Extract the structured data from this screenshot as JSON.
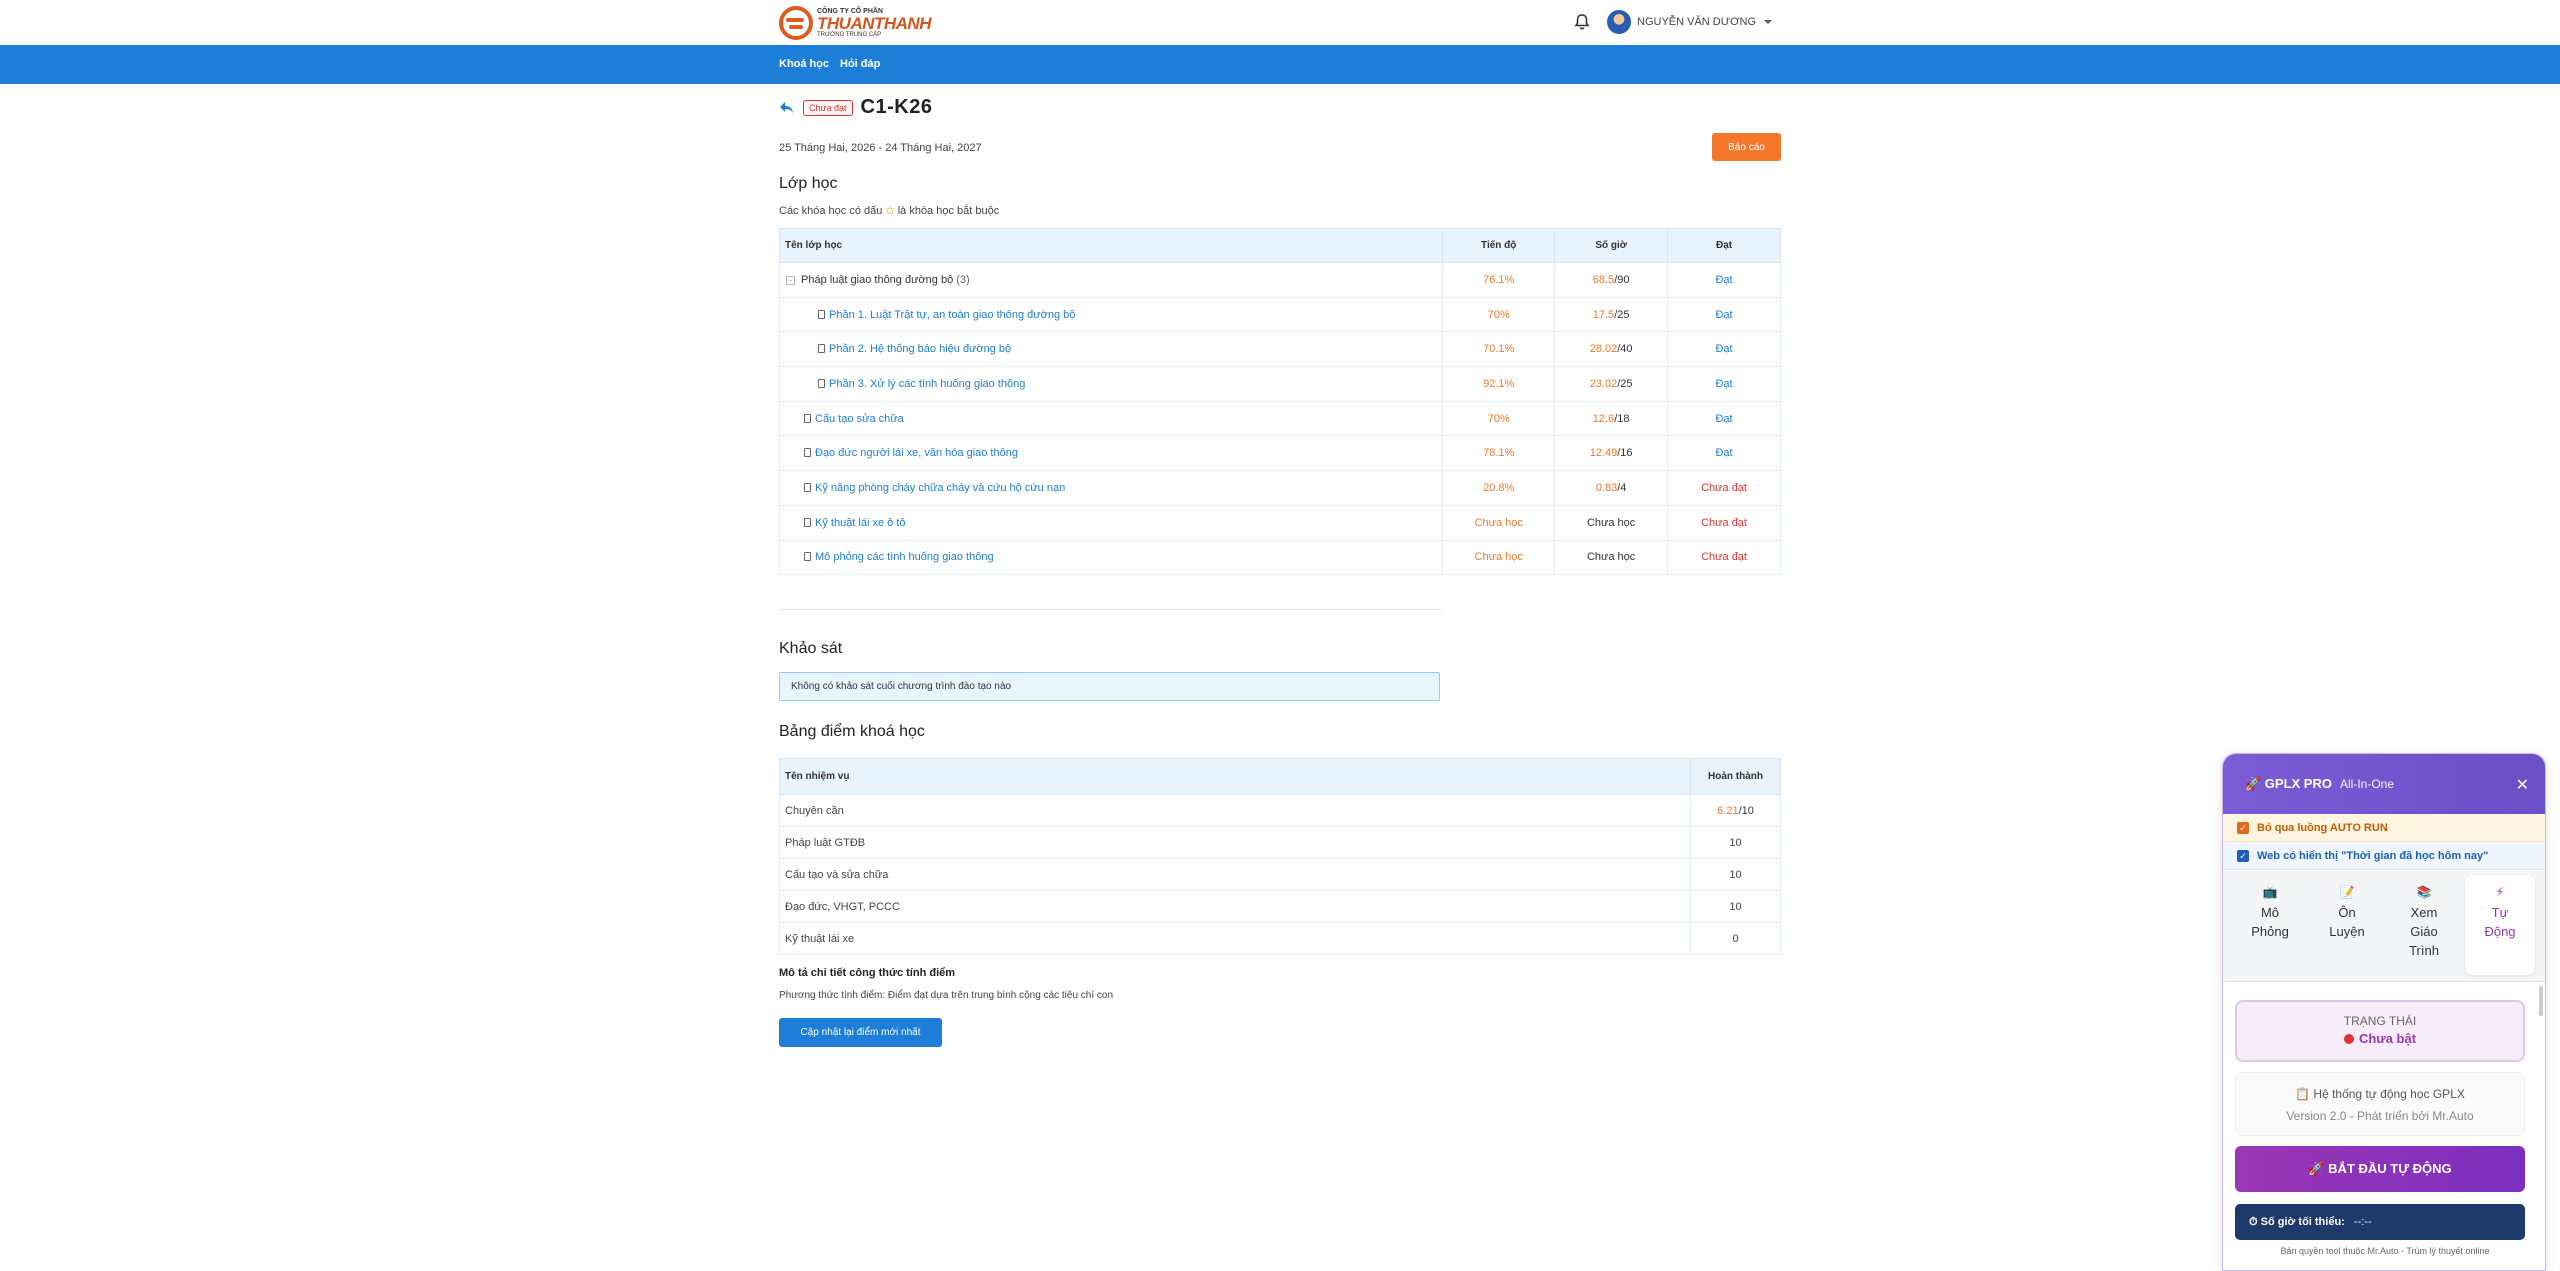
{
  "header": {
    "logo": {
      "small": "CÔNG TY CỔ PHẦN",
      "big": "THUANTHANH",
      "sub": "TRƯỜNG TRUNG CẤP"
    },
    "user_name": "NGUYỄN VĂN DƯƠNG"
  },
  "nav": {
    "courses": "Khoá học",
    "faq": "Hỏi đáp"
  },
  "course": {
    "status_badge": "Chưa đạt",
    "title": "C1-K26",
    "date_range": "25 Tháng Hai, 2026 - 24 Tháng Hai, 2027",
    "report_button": "Báo cáo"
  },
  "classes": {
    "heading": "Lớp học",
    "note_before": "Các khóa học có dấu",
    "note_star": "✩",
    "note_after": "là khóa học bắt buộc",
    "columns": [
      "Tên lớp học",
      "Tiến độ",
      "Số giờ",
      "Đạt"
    ],
    "rows": [
      {
        "name": "Pháp luật giao thông đường bộ",
        "count": "(3)",
        "progress": "76.1%",
        "hours": "68.5",
        "hours_total": "/90",
        "pass": "Đạt"
      },
      {
        "name": "Phần 1. Luật Trật tự, an toàn giao thông đường bộ",
        "progress": "70%",
        "hours": "17.5",
        "hours_total": "/25",
        "pass": "Đạt"
      },
      {
        "name": "Phần 2. Hệ thống báo hiệu đường bộ",
        "progress": "70.1%",
        "hours": "28.02",
        "hours_total": "/40",
        "pass": "Đạt"
      },
      {
        "name": "Phần 3. Xử lý các tình huống giao thông",
        "progress": "92.1%",
        "hours": "23.02",
        "hours_total": "/25",
        "pass": "Đạt"
      },
      {
        "name": "Cấu tạo sửa chữa",
        "progress": "70%",
        "hours": "12.6",
        "hours_total": "/18",
        "pass": "Đạt"
      },
      {
        "name": "Đạo đức người lái xe, văn hóa giao thông",
        "progress": "78.1%",
        "hours": "12.49",
        "hours_total": "/16",
        "pass": "Đạt"
      },
      {
        "name": "Kỹ năng phòng cháy chữa cháy và cứu hộ cứu nạn",
        "progress": "20.8%",
        "hours": "0.83",
        "hours_total": "/4",
        "pass": "Chưa đạt"
      },
      {
        "name": "Kỹ thuật lái xe ô tô",
        "progress": "Chưa học",
        "hours_text": "Chưa học",
        "pass": "Chưa đạt"
      },
      {
        "name": "Mô phỏng các tình huống giao thông",
        "progress": "Chưa học",
        "hours_text": "Chưa học",
        "pass": "Chưa đạt"
      }
    ]
  },
  "survey": {
    "heading": "Khảo sát",
    "message": "Không có khảo sát cuối chương trình đào tạo nào"
  },
  "scores": {
    "heading": "Bảng điểm khoá học",
    "columns": [
      "Tên nhiệm vụ",
      "Hoàn thành"
    ],
    "rows": [
      {
        "name": "Chuyên cần",
        "score": "6.21",
        "total": "/10"
      },
      {
        "name": "Pháp luật GTĐB",
        "score": "10"
      },
      {
        "name": "Cấu tạo và sửa chữa",
        "score": "10"
      },
      {
        "name": "Đạo đức, VHGT, PCCC",
        "score": "10"
      },
      {
        "name": "Kỹ thuật lái xe",
        "score": "0"
      }
    ],
    "formula_title": "Mô tả chi tiết công thức tính điểm",
    "formula_desc": "Phương thức tính điểm: Điểm đạt dựa trên trung bình cộng các tiêu chí con",
    "update_button": "Cập nhật lại điểm mới nhất"
  },
  "widget": {
    "brand": "🚀 GPLX PRO",
    "subtitle": "All-In-One",
    "close": "✕",
    "check1": "Bỏ qua luồng AUTO RUN",
    "check2": "Web có hiển thị \"Thời gian đã học hôm nay\"",
    "tabs": [
      {
        "icon": "📺",
        "l1": "Mô",
        "l2": "Phỏng"
      },
      {
        "icon": "📝",
        "l1": "Ôn",
        "l2": "Luyện"
      },
      {
        "icon": "📚",
        "l1": "Xem",
        "l2": "Giáo",
        "l3": "Trình"
      },
      {
        "icon": "⚡",
        "l1": "Tự",
        "l2": "Động"
      }
    ],
    "status_label": "TRẠNG THÁI",
    "status_value": "Chưa bật",
    "info_title": "📋 Hệ thống tự động học GPLX",
    "info_version": "Version 2.0 - Phát triển bởi Mr.Auto",
    "start_button": "🚀 BẮT ĐẦU TỰ ĐỘNG",
    "hours_label": "⏱ Số giờ tối thiểu:",
    "hours_value": "--:--",
    "copyright": "Bản quyền tool thuộc Mr.Auto - Trùm lý thuyết online"
  }
}
